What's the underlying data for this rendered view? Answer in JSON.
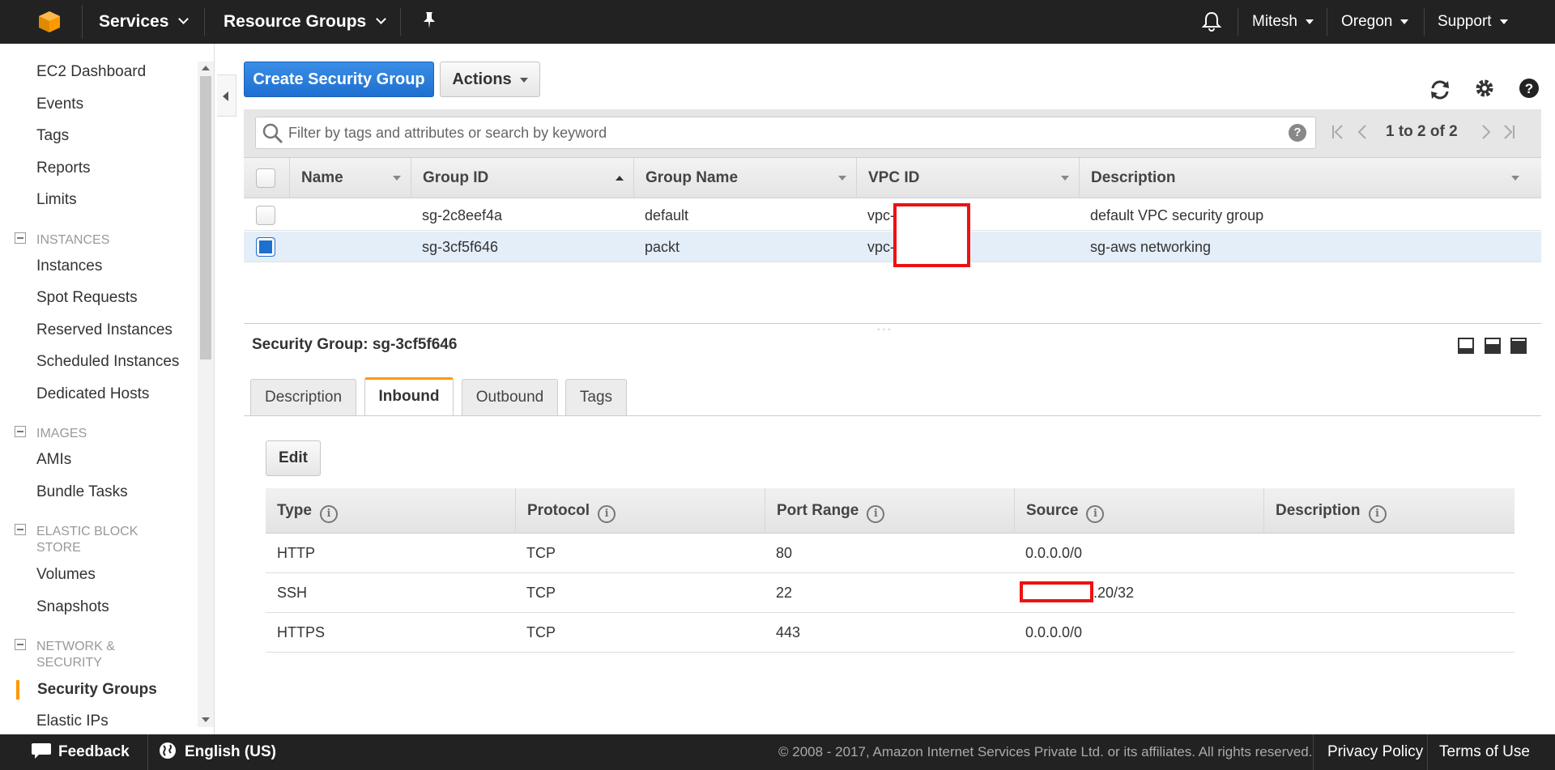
{
  "topnav": {
    "services": "Services",
    "resource_groups": "Resource Groups",
    "user": "Mitesh",
    "region": "Oregon",
    "support": "Support"
  },
  "sidebar": {
    "links_top": [
      "EC2 Dashboard",
      "Events",
      "Tags",
      "Reports",
      "Limits"
    ],
    "section_instances": "INSTANCES",
    "instances": [
      "Instances",
      "Spot Requests",
      "Reserved Instances",
      "Scheduled Instances",
      "Dedicated Hosts"
    ],
    "section_images": "IMAGES",
    "images": [
      "AMIs",
      "Bundle Tasks"
    ],
    "section_ebs": "ELASTIC BLOCK STORE",
    "ebs": [
      "Volumes",
      "Snapshots"
    ],
    "section_network": "NETWORK & SECURITY",
    "network": [
      "Security Groups",
      "Elastic IPs"
    ],
    "active_item": "Security Groups"
  },
  "toolbar": {
    "create_label": "Create Security Group",
    "actions_label": "Actions"
  },
  "filter": {
    "placeholder": "Filter by tags and attributes or search by keyword",
    "pager_text": "1 to 2 of 2"
  },
  "grid": {
    "columns": [
      "Name",
      "Group ID",
      "Group Name",
      "VPC ID",
      "Description"
    ],
    "rows": [
      {
        "name": "",
        "group_id": "sg-2c8eef4a",
        "group_name": "default",
        "vpc_id": "vpc-",
        "description": "default VPC security group",
        "selected": false
      },
      {
        "name": "",
        "group_id": "sg-3cf5f646",
        "group_name": "packt",
        "vpc_id": "vpc-",
        "description": "sg-aws networking",
        "selected": true
      }
    ]
  },
  "details": {
    "title": "Security Group: sg-3cf5f646",
    "tabs": [
      "Description",
      "Inbound",
      "Outbound",
      "Tags"
    ],
    "active_tab": "Inbound",
    "edit_label": "Edit",
    "rule_columns": [
      "Type",
      "Protocol",
      "Port Range",
      "Source",
      "Description"
    ],
    "rules": [
      {
        "type": "HTTP",
        "protocol": "TCP",
        "port_range": "80",
        "source": "0.0.0.0/0",
        "description": ""
      },
      {
        "type": "SSH",
        "protocol": "TCP",
        "port_range": "22",
        "source": ".20/32",
        "description": ""
      },
      {
        "type": "HTTPS",
        "protocol": "TCP",
        "port_range": "443",
        "source": "0.0.0.0/0",
        "description": ""
      }
    ]
  },
  "footer": {
    "feedback": "Feedback",
    "language": "English (US)",
    "copyright": "© 2008 - 2017, Amazon Internet Services Private Ltd. or its affiliates. All rights reserved.",
    "privacy": "Privacy Policy",
    "terms": "Terms of Use"
  },
  "colors": {
    "accent_orange": "#ff9900",
    "primary_blue": "#1e6fd0",
    "redaction_red": "#ee1111"
  }
}
